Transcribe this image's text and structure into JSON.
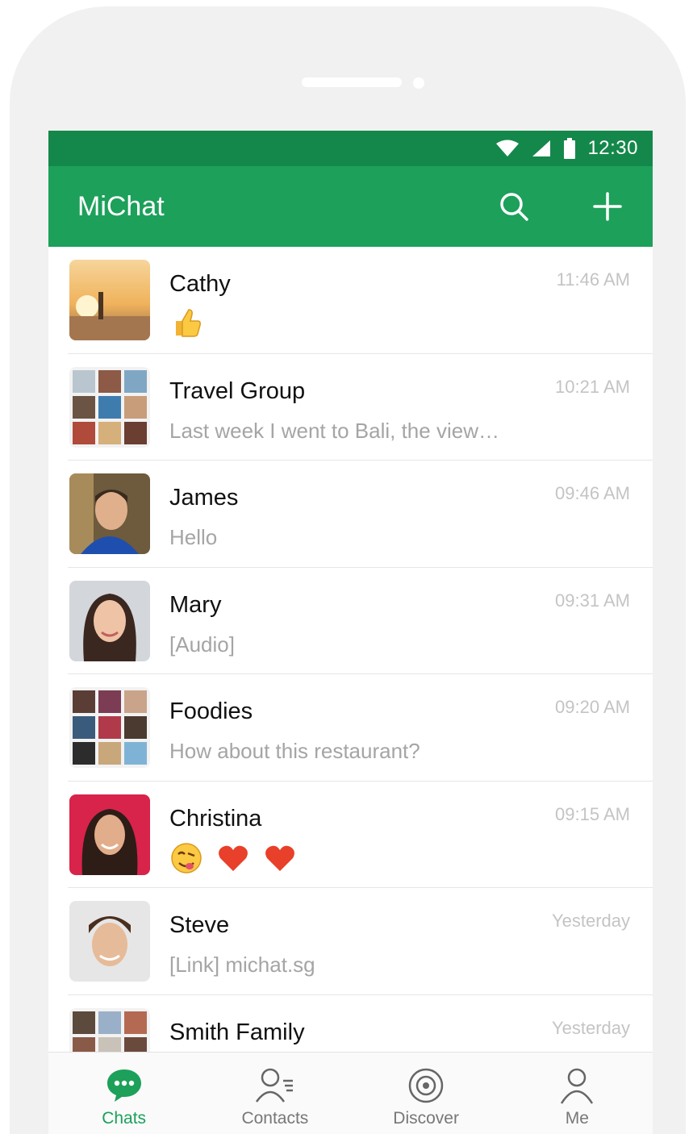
{
  "status_bar": {
    "time": "12:30"
  },
  "app_bar": {
    "title": "MiChat",
    "search_icon": "search-icon",
    "add_icon": "plus-icon"
  },
  "chats": [
    {
      "name": "Cathy",
      "time": "11:46 AM",
      "preview": "",
      "preview_emoji": [
        "thumbs-up"
      ]
    },
    {
      "name": "Travel Group",
      "time": "10:21 AM",
      "preview": "Last week I went to Bali, the view…"
    },
    {
      "name": "James",
      "time": "09:46 AM",
      "preview": "Hello"
    },
    {
      "name": "Mary",
      "time": "09:31 AM",
      "preview": "[Audio]"
    },
    {
      "name": "Foodies",
      "time": "09:20 AM",
      "preview": "How about this restaurant?"
    },
    {
      "name": "Christina",
      "time": "09:15 AM",
      "preview": "",
      "preview_emoji": [
        "face-savoring",
        "red-heart",
        "red-heart"
      ]
    },
    {
      "name": "Steve",
      "time": "Yesterday",
      "preview": "[Link] michat.sg"
    },
    {
      "name": "Smith Family",
      "time": "Yesterday",
      "preview": ""
    }
  ],
  "tabs": [
    {
      "label": "Chats",
      "icon": "chat-bubble-icon",
      "active": true
    },
    {
      "label": "Contacts",
      "icon": "contacts-icon",
      "active": false
    },
    {
      "label": "Discover",
      "icon": "discover-icon",
      "active": false
    },
    {
      "label": "Me",
      "icon": "person-icon",
      "active": false
    }
  ],
  "colors": {
    "primary": "#1ca05a",
    "status_bar": "#14884a",
    "muted_text": "#a5a5a5",
    "time_text": "#c4c4c4"
  }
}
